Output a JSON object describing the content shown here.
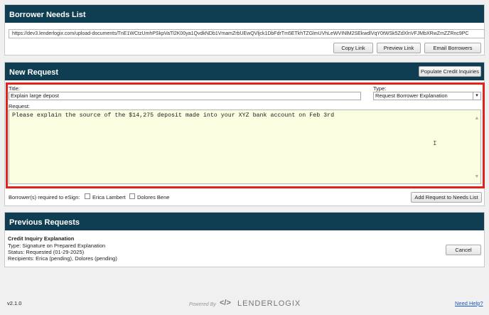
{
  "needs": {
    "title": "Borrower Needs List",
    "url": "https://dev3.lenderlogix.com/upload-documents/TnE1WCtzUmhPSkpVaTl2K00ya1QvdkNDb1VmamZrbUEwQVljck1DbFdrTm5ETkhTZGlmUVhLeWVINlM2SEkwdlVqY0tWSk5ZdXlnVFJMbXRwZmZZRnc9PC",
    "buttons": {
      "copy": "Copy Link",
      "preview": "Preview Link",
      "email": "Email Borrowers"
    }
  },
  "new_request": {
    "title": "New Request",
    "populate_button": "Populate Credit Inquiries",
    "title_label": "Title:",
    "title_value": "Explain large depost",
    "type_label": "Type:",
    "type_value": "Request Borrower Explanation",
    "request_label": "Request:",
    "request_text": "Please explain the source of the $14,275 deposit made into your XYZ bank account on Feb 3rd",
    "esign_label": "Borrower(s) required to eSign:",
    "borrowers": [
      "Erica Lambert",
      "Dolores Bene"
    ],
    "add_button": "Add Request to Needs List"
  },
  "previous": {
    "title": "Previous Requests",
    "item": {
      "name": "Credit Inquiry Explanation",
      "type": "Type: Signature on Prepared Explanation",
      "status": "Status: Requested (01-29-2025)",
      "recipients": "Recipients: Erica (pending), Dolores (pending)",
      "cancel": "Cancel"
    }
  },
  "footer": {
    "version": "v2.1.0",
    "powered_by": "Powered By",
    "brand": "LENDERLOGIX",
    "help": "Need Help?"
  },
  "colors": {
    "header": "#0f3d52",
    "highlight": "#e0231b",
    "textarea_bg": "#fbfde0"
  }
}
